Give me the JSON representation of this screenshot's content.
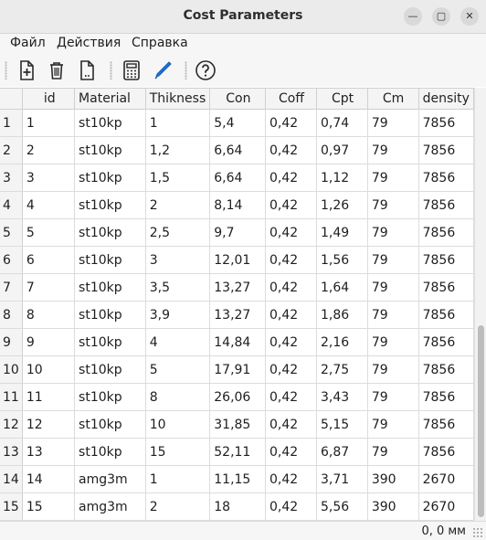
{
  "window": {
    "title": "Cost Parameters",
    "minimize_glyph": "—",
    "maximize_glyph": "▢",
    "close_glyph": "✕"
  },
  "menu": {
    "file": "Файл",
    "actions": "Действия",
    "help": "Справка"
  },
  "toolbar": {
    "buttons": [
      "add-file-icon",
      "trash-icon",
      "dotted-file-icon",
      "calculator-icon",
      "pen-icon",
      "help-icon"
    ]
  },
  "table": {
    "columns": [
      "id",
      "Material",
      "Thikness",
      "Con",
      "Coff",
      "Cpt",
      "Cm",
      "density"
    ],
    "rows": [
      {
        "n": "1",
        "cells": [
          "1",
          "st10kp",
          "1",
          "5,4",
          "0,42",
          "0,74",
          "79",
          "7856"
        ]
      },
      {
        "n": "2",
        "cells": [
          "2",
          "st10kp",
          "1,2",
          "6,64",
          "0,42",
          "0,97",
          "79",
          "7856"
        ]
      },
      {
        "n": "3",
        "cells": [
          "3",
          "st10kp",
          "1,5",
          "6,64",
          "0,42",
          "1,12",
          "79",
          "7856"
        ]
      },
      {
        "n": "4",
        "cells": [
          "4",
          "st10kp",
          "2",
          "8,14",
          "0,42",
          "1,26",
          "79",
          "7856"
        ]
      },
      {
        "n": "5",
        "cells": [
          "5",
          "st10kp",
          "2,5",
          "9,7",
          "0,42",
          "1,49",
          "79",
          "7856"
        ]
      },
      {
        "n": "6",
        "cells": [
          "6",
          "st10kp",
          "3",
          "12,01",
          "0,42",
          "1,56",
          "79",
          "7856"
        ]
      },
      {
        "n": "7",
        "cells": [
          "7",
          "st10kp",
          "3,5",
          "13,27",
          "0,42",
          "1,64",
          "79",
          "7856"
        ]
      },
      {
        "n": "8",
        "cells": [
          "8",
          "st10kp",
          "3,9",
          "13,27",
          "0,42",
          "1,86",
          "79",
          "7856"
        ]
      },
      {
        "n": "9",
        "cells": [
          "9",
          "st10kp",
          "4",
          "14,84",
          "0,42",
          "2,16",
          "79",
          "7856"
        ]
      },
      {
        "n": "10",
        "cells": [
          "10",
          "st10kp",
          "5",
          "17,91",
          "0,42",
          "2,75",
          "79",
          "7856"
        ]
      },
      {
        "n": "11",
        "cells": [
          "11",
          "st10kp",
          "8",
          "26,06",
          "0,42",
          "3,43",
          "79",
          "7856"
        ]
      },
      {
        "n": "12",
        "cells": [
          "12",
          "st10kp",
          "10",
          "31,85",
          "0,42",
          "5,15",
          "79",
          "7856"
        ]
      },
      {
        "n": "13",
        "cells": [
          "13",
          "st10kp",
          "15",
          "52,11",
          "0,42",
          "6,87",
          "79",
          "7856"
        ]
      },
      {
        "n": "14",
        "cells": [
          "14",
          "amg3m",
          "1",
          "11,15",
          "0,42",
          "3,71",
          "390",
          "2670"
        ]
      },
      {
        "n": "15",
        "cells": [
          "15",
          "amg3m",
          "2",
          "18",
          "0,42",
          "5,56",
          "390",
          "2670"
        ]
      }
    ]
  },
  "status": {
    "coords": "0, 0 мм"
  },
  "colors": {
    "titlebar": "#ebebeb",
    "header": "#f4f4f4",
    "grid_line": "#dcdcdc",
    "pen_blue": "#1c71d8"
  }
}
